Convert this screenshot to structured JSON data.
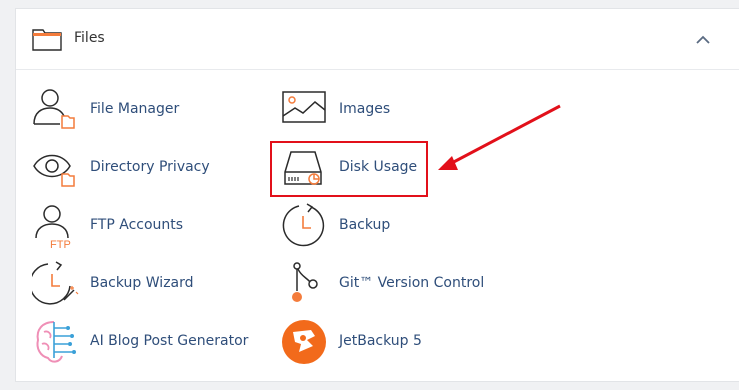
{
  "section": {
    "title": "Files",
    "collapse_icon": "chevron-up-icon"
  },
  "items": [
    {
      "label": "File Manager",
      "icon": "file-manager-icon"
    },
    {
      "label": "Images",
      "icon": "images-icon"
    },
    {
      "label": "Directory Privacy",
      "icon": "directory-privacy-icon"
    },
    {
      "label": "Disk Usage",
      "icon": "disk-usage-icon"
    },
    {
      "label": "FTP Accounts",
      "icon": "ftp-accounts-icon"
    },
    {
      "label": "Backup",
      "icon": "backup-icon"
    },
    {
      "label": "Backup Wizard",
      "icon": "backup-wizard-icon"
    },
    {
      "label": "Git™ Version Control",
      "icon": "git-version-control-icon"
    },
    {
      "label": "AI Blog Post Generator",
      "icon": "ai-blog-post-generator-icon"
    },
    {
      "label": "JetBackup 5",
      "icon": "jetbackup-icon"
    }
  ],
  "annotation": {
    "highlighted_item": "Disk Usage",
    "highlight_color": "#e2101a"
  },
  "colors": {
    "accent": "#f47c3c",
    "label": "#2f4e7a",
    "icon_stroke": "#2b2b2b"
  }
}
